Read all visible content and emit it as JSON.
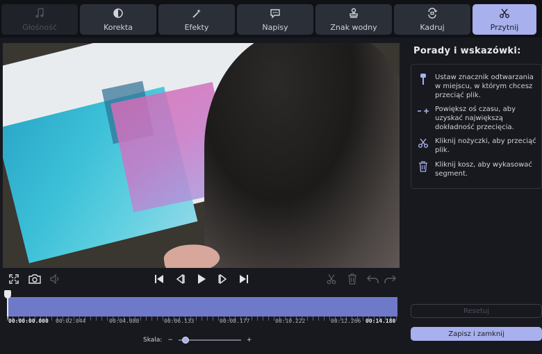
{
  "tabs": [
    {
      "label": "Głośność",
      "icon": "music-note-icon",
      "state": "disabled"
    },
    {
      "label": "Korekta",
      "icon": "contrast-icon",
      "state": "normal"
    },
    {
      "label": "Efekty",
      "icon": "magic-wand-icon",
      "state": "normal"
    },
    {
      "label": "Napisy",
      "icon": "speech-bubble-icon",
      "state": "normal"
    },
    {
      "label": "Znak wodny",
      "icon": "stamp-icon",
      "state": "normal"
    },
    {
      "label": "Kadruj",
      "icon": "crop-rotate-icon",
      "state": "normal"
    },
    {
      "label": "Przytnij",
      "icon": "scissors-icon",
      "state": "active"
    }
  ],
  "player": {
    "controls": [
      "fullscreen-icon",
      "snapshot-camera-icon",
      "volume-icon",
      "skip-to-start-icon",
      "previous-frame-icon",
      "play-icon",
      "next-frame-icon",
      "skip-to-end-icon",
      "cut-scissors-icon",
      "delete-trash-icon",
      "undo-icon",
      "redo-icon"
    ]
  },
  "timeline": {
    "current_time": "00:00:00.000",
    "ticks": [
      "00:02.044",
      "00:04.088",
      "00:06.133",
      "00:08.177",
      "00:10.222",
      "00:12.266"
    ],
    "end_time": "00:14.180"
  },
  "scale": {
    "label": "Skala:",
    "minus": "−",
    "plus": "+",
    "value": 0.1
  },
  "panel": {
    "title": "Porady i wskazówki:",
    "tips": [
      {
        "icon": "playhead-marker-icon",
        "text": "Ustaw znacznik odtwarzania w miejscu, w którym chcesz przeciąć plik."
      },
      {
        "icon": "zoom-timeline-icon",
        "text": "Powiększ oś czasu, aby uzyskać największą dokładność przecięcia."
      },
      {
        "icon": "scissors-icon",
        "text": "Kliknij nożyczki, aby przeciąć plik."
      },
      {
        "icon": "trash-icon",
        "text": "Kliknij kosz, aby wykasować segment."
      }
    ],
    "reset_label": "Resetuj",
    "save_label": "Zapisz i zamknij"
  },
  "colors": {
    "accent": "#a9b0ee",
    "track": "#6f79c9",
    "background": "#17191f"
  }
}
